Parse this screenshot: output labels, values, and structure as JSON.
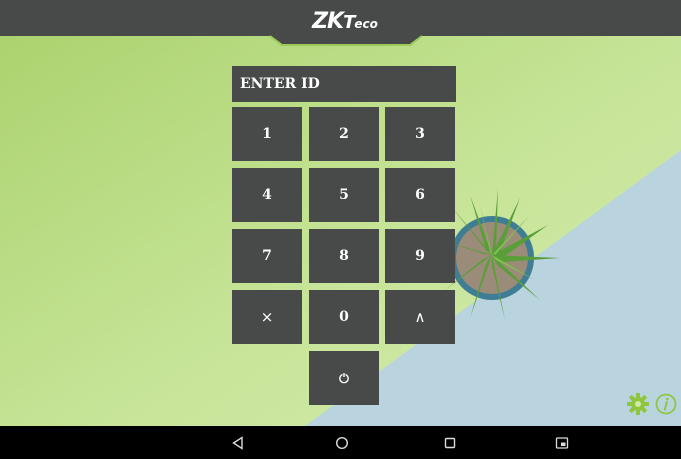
{
  "header": {
    "logo_zk": "ZK",
    "logo_t": "T",
    "logo_eco": "eco"
  },
  "keypad": {
    "id_label": "ENTER ID",
    "keys": [
      "1",
      "2",
      "3",
      "4",
      "5",
      "6",
      "7",
      "8",
      "9",
      "×",
      "0",
      "∧"
    ],
    "ok_icon": "power-icon"
  },
  "icons": {
    "settings": "gear-icon",
    "info": "info-icon",
    "nav_back": "back-triangle-icon",
    "nav_home": "home-circle-icon",
    "nav_recents": "recents-square-icon",
    "nav_screenshot": "screenshot-icon"
  },
  "colors": {
    "panel": "#474a48",
    "background_green": "#bfe08a",
    "background_blue": "#b7d3de",
    "icon_green": "#8fc63f",
    "text": "#ffffff"
  }
}
